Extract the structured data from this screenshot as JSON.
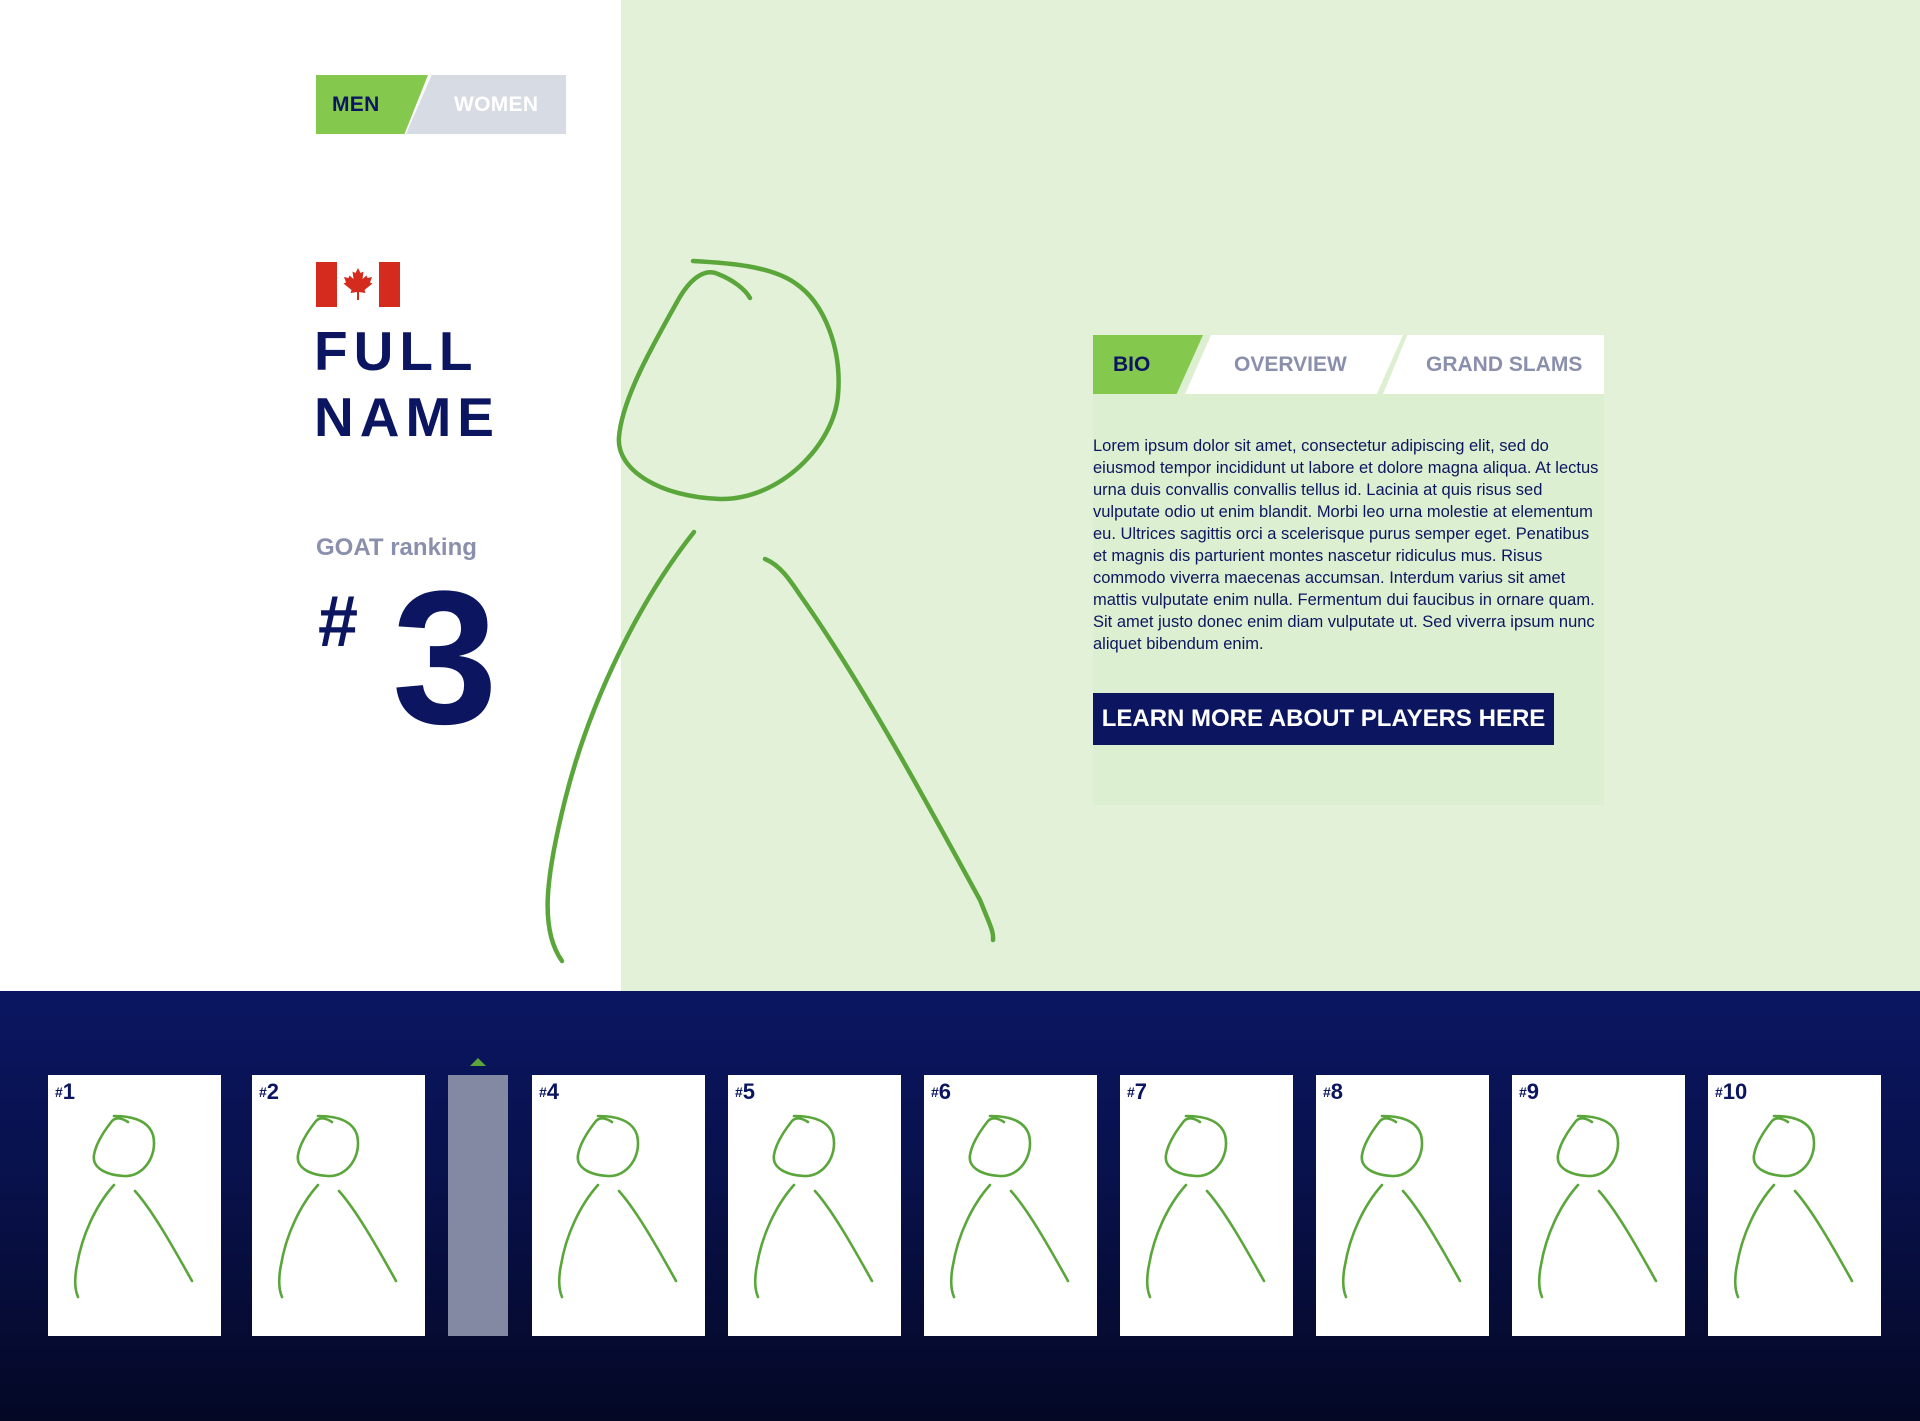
{
  "gender_toggle": {
    "men_label": "MEN",
    "women_label": "WOMEN",
    "selected": "MEN"
  },
  "player": {
    "country_flag": "canada-flag-icon",
    "name_line1": "FULL",
    "name_line2": "NAME",
    "ranking_label": "GOAT ranking",
    "ranking_hash": "#",
    "ranking_number": "3"
  },
  "bio_tabs": {
    "bio": "BIO",
    "overview": "OVERVIEW",
    "grand_slams": "GRAND SLAMS",
    "selected": "BIO"
  },
  "bio_text": "Lorem ipsum dolor sit amet, consectetur adipiscing elit, sed do eiusmod tempor incididunt ut labore et dolore magna aliqua. At lectus urna duis convallis convallis tellus id. Lacinia at quis risus sed vulputate odio ut enim blandit. Morbi leo urna molestie at elementum eu. Ultrices sagittis orci a scelerisque purus semper eget. Penatibus et magnis dis parturient montes nascetur ridiculus mus. Risus commodo viverra maecenas accumsan. Interdum varius sit amet mattis vulputate enim nulla. Fermentum dui faucibus in ornare quam. Sit amet justo donec enim diam vulputate ut. Sed viverra ipsum nunc aliquet bibendum enim.",
  "cta_label": "LEARN MORE ABOUT PLAYERS HERE",
  "carousel": {
    "selected_rank": "3",
    "thumbnails": [
      {
        "hash": "#",
        "rank": "1"
      },
      {
        "hash": "#",
        "rank": "2"
      },
      {
        "hash": "#",
        "rank": "4"
      },
      {
        "hash": "#",
        "rank": "5"
      },
      {
        "hash": "#",
        "rank": "6"
      },
      {
        "hash": "#",
        "rank": "7"
      },
      {
        "hash": "#",
        "rank": "8"
      },
      {
        "hash": "#",
        "rank": "9"
      },
      {
        "hash": "#",
        "rank": "10"
      }
    ]
  },
  "colors": {
    "navy": "#0c1660",
    "accent_green": "#84c94e",
    "panel_green": "#e2f1d8",
    "sketch_green": "#5aa63a",
    "muted_text": "#8a90ac",
    "toggle_gray": "#d7dbe3"
  }
}
